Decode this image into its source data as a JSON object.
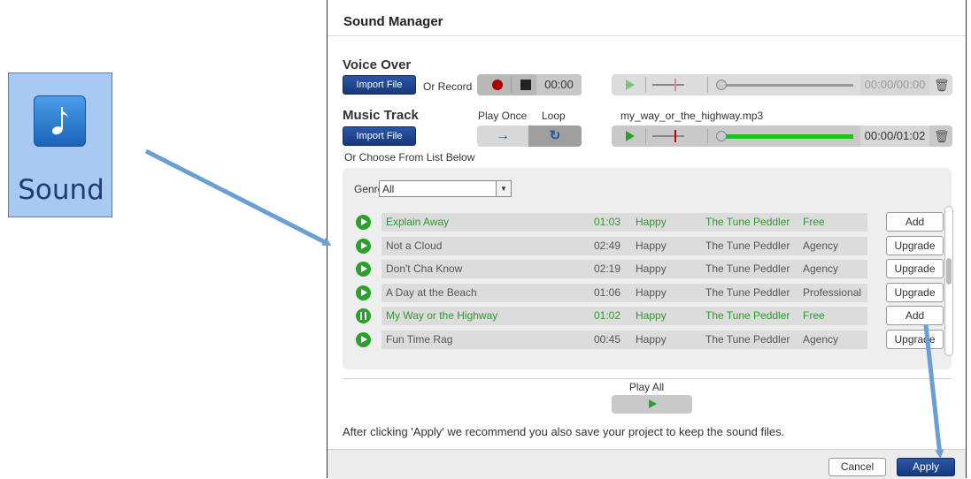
{
  "ribbon": {
    "sound_label": "Sound",
    "icon": "music-note-icon"
  },
  "dialog": {
    "title": "Sound Manager",
    "voice_over": {
      "title": "Voice Over",
      "import_label": "Import File",
      "or_record_label": "Or Record",
      "record_time": "00:00",
      "player_time": "00:00/00:00"
    },
    "music_track": {
      "title": "Music Track",
      "import_label": "Import File",
      "play_once_label": "Play Once",
      "loop_label": "Loop",
      "filename": "my_way_or_the_highway.mp3",
      "player_time": "00:00/01:02",
      "progress": 1.0,
      "choose_label": "Or Choose From List Below"
    },
    "list": {
      "genre_label": "Genre",
      "genre_value": "All",
      "rows": [
        {
          "title": "Explain Away",
          "duration": "01:03",
          "mood": "Happy",
          "artist": "The Tune Peddler",
          "license": "Free",
          "action": "Add",
          "highlight": true,
          "playing": false
        },
        {
          "title": "Not a Cloud",
          "duration": "02:49",
          "mood": "Happy",
          "artist": "The Tune Peddler",
          "license": "Agency",
          "action": "Upgrade",
          "highlight": false,
          "playing": false
        },
        {
          "title": "Don't Cha Know",
          "duration": "02:19",
          "mood": "Happy",
          "artist": "The Tune Peddler",
          "license": "Agency",
          "action": "Upgrade",
          "highlight": false,
          "playing": false
        },
        {
          "title": "A Day at the Beach",
          "duration": "01:06",
          "mood": "Happy",
          "artist": "The Tune Peddler",
          "license": "Professional",
          "action": "Upgrade",
          "highlight": false,
          "playing": false
        },
        {
          "title": "My Way or the Highway",
          "duration": "01:02",
          "mood": "Happy",
          "artist": "The Tune Peddler",
          "license": "Free",
          "action": "Add",
          "highlight": true,
          "playing": true
        },
        {
          "title": "Fun Time Rag",
          "duration": "00:45",
          "mood": "Happy",
          "artist": "The Tune Peddler",
          "license": "Agency",
          "action": "Upgrade",
          "highlight": false,
          "playing": false
        }
      ]
    },
    "play_all_label": "Play All",
    "note": "After clicking 'Apply' we recommend you also save your project to keep the sound files.",
    "cancel_label": "Cancel",
    "apply_label": "Apply"
  },
  "colors": {
    "accent": "#1f4a96",
    "play_green": "#2ca02c",
    "arrow_blue": "#6a9fd4"
  }
}
